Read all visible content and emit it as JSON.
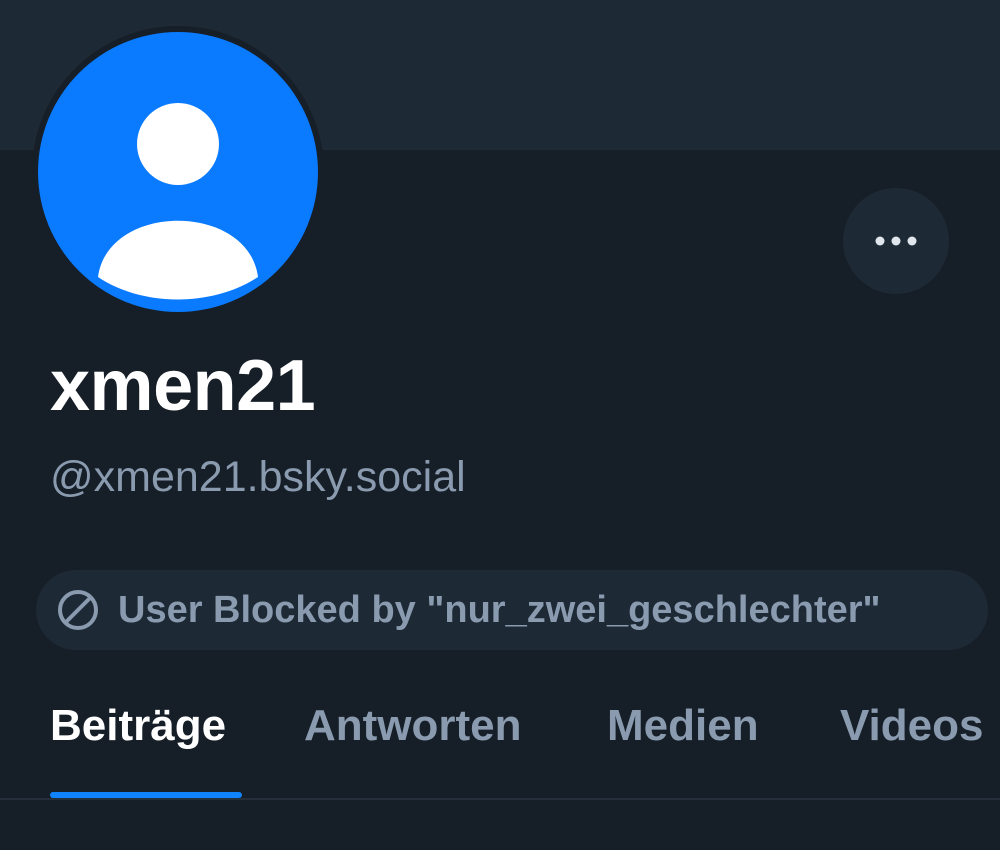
{
  "profile": {
    "display_name": "xmen21",
    "handle": "@xmen21.bsky.social",
    "avatar_icon": "default-avatar-icon",
    "avatar_color": "#0a7aff"
  },
  "actions": {
    "more_icon": "ellipsis-icon"
  },
  "block_notice": {
    "icon": "block-icon",
    "text": "User Blocked by \"nur_zwei_geschlechter\""
  },
  "tabs": [
    {
      "label": "Beiträge",
      "active": true
    },
    {
      "label": "Antworten",
      "active": false
    },
    {
      "label": "Medien",
      "active": false
    },
    {
      "label": "Videos",
      "active": false
    }
  ],
  "colors": {
    "background": "#161e27",
    "surface": "#1e2936",
    "accent": "#1083fe",
    "muted_text": "#8a9bb0"
  }
}
